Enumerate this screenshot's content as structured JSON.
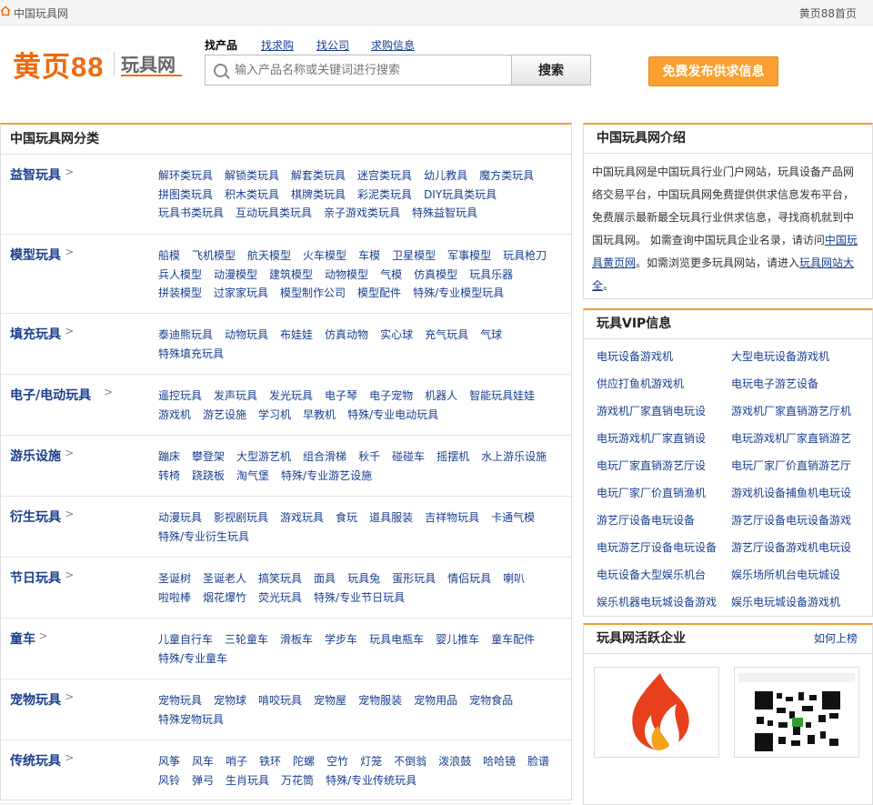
{
  "topbar": {
    "site": "中国玩具网",
    "right": "黄页88首页"
  },
  "header": {
    "logo": "黄页88",
    "logo_sub": "玩具网",
    "tabs": [
      "找产品",
      "找求购",
      "找公司",
      "求购信息"
    ],
    "search_placeholder": "输入产品名称或关键词进行搜索",
    "search_button": "搜索",
    "publish_button": "免费发布供求信息"
  },
  "left": {
    "title": "中国玩具网分类",
    "categories": [
      {
        "name": "益智玩具",
        "links": [
          "解环类玩具",
          "解锁类玩具",
          "解套类玩具",
          "迷宫类玩具",
          "幼儿教具",
          "魔方类玩具",
          "拼图类玩具",
          "积木类玩具",
          "棋牌类玩具",
          "彩泥类玩具",
          "DIY玩具类玩具",
          "玩具书类玩具",
          "互动玩具类玩具",
          "亲子游戏类玩具",
          "特殊益智玩具"
        ]
      },
      {
        "name": "模型玩具",
        "links": [
          "船模",
          "飞机模型",
          "航天模型",
          "火车模型",
          "车模",
          "卫星模型",
          "军事模型",
          "玩具枪刀",
          "兵人模型",
          "动漫模型",
          "建筑模型",
          "动物模型",
          "气模",
          "仿真模型",
          "玩具乐器",
          "拼装模型",
          "过家家玩具",
          "模型制作公司",
          "模型配件",
          "特殊/专业模型玩具"
        ]
      },
      {
        "name": "填充玩具",
        "links": [
          "泰迪熊玩具",
          "动物玩具",
          "布娃娃",
          "仿真动物",
          "实心球",
          "充气玩具",
          "气球",
          "特殊填充玩具"
        ]
      },
      {
        "name": "电子/电动玩具",
        "links": [
          "遥控玩具",
          "发声玩具",
          "发光玩具",
          "电子琴",
          "电子宠物",
          "机器人",
          "智能玩具娃娃",
          "游戏机",
          "游艺设施",
          "学习机",
          "早教机",
          "特殊/专业电动玩具"
        ]
      },
      {
        "name": "游乐设施",
        "links": [
          "蹦床",
          "攀登架",
          "大型游艺机",
          "组合滑梯",
          "秋千",
          "碰碰车",
          "摇摆机",
          "水上游乐设施",
          "转椅",
          "跷跷板",
          "淘气堡",
          "特殊/专业游艺设施"
        ]
      },
      {
        "name": "衍生玩具",
        "links": [
          "动漫玩具",
          "影视剧玩具",
          "游戏玩具",
          "食玩",
          "道具服装",
          "吉祥物玩具",
          "卡通气模",
          "特殊/专业衍生玩具"
        ]
      },
      {
        "name": "节日玩具",
        "links": [
          "圣诞树",
          "圣诞老人",
          "搞笑玩具",
          "面具",
          "玩具兔",
          "蛋形玩具",
          "情侣玩具",
          "喇叭",
          "啦啦棒",
          "烟花爆竹",
          "荧光玩具",
          "特殊/专业节日玩具"
        ]
      },
      {
        "name": "童车",
        "links": [
          "儿童自行车",
          "三轮童车",
          "滑板车",
          "学步车",
          "玩具电瓶车",
          "婴儿推车",
          "童车配件",
          "特殊/专业童车"
        ]
      },
      {
        "name": "宠物玩具",
        "links": [
          "宠物玩具",
          "宠物球",
          "啃咬玩具",
          "宠物屋",
          "宠物服装",
          "宠物用品",
          "宠物食品",
          "特殊宠物玩具"
        ]
      },
      {
        "name": "传统玩具",
        "links": [
          "风筝",
          "风车",
          "哨子",
          "铁环",
          "陀螺",
          "空竹",
          "灯笼",
          "不倒翁",
          "泼浪鼓",
          "哈哈镜",
          "脸谱",
          "风铃",
          "弹弓",
          "生肖玩具",
          "万花筒",
          "特殊/专业传统玩具"
        ]
      }
    ]
  },
  "intro": {
    "title": "中国玩具网介绍",
    "text1": "中国玩具网是中国玩具行业门户网站，玩具设备产品网络交易平台，中国玩具网免费提供供求信息发布平台，免费展示最新最全玩具行业供求信息，寻找商机就到中国玩具网。 如需查询中国玩具企业名录，请访问",
    "link1": "中国玩具黄页网",
    "text2": "。如需浏览更多玩具网站，请进入",
    "link2": "玩具网站大全",
    "text3": "。"
  },
  "vip": {
    "title": "玩具VIP信息",
    "items": [
      "电玩设备游戏机",
      "大型电玩设备游戏机",
      "供应打鱼机游戏机",
      "电玩电子游艺设备",
      "游戏机厂家直销电玩设",
      "游戏机厂家直销游艺厅机",
      "电玩游戏机厂家直销设",
      "电玩游戏机厂家直销游艺",
      "电玩厂家直销游艺厅设",
      "电玩厂家厂价直销游艺厅",
      "电玩厂家厂价直销渔机",
      "游戏机设备捕鱼机电玩设",
      "游艺厅设备电玩设备",
      "游艺厅设备电玩设备游戏",
      "电玩游艺厅设备电玩设备",
      "游艺厅设备游戏机电玩设",
      "电玩设备大型娱乐机台",
      "娱乐场所机台电玩城设",
      "娱乐机器电玩城设备游戏",
      "娱乐电玩城设备游戏机"
    ]
  },
  "active": {
    "title": "玩具网活跃企业",
    "more": "如何上榜"
  },
  "colors": {
    "accent": "#f06a0c",
    "link": "#1a3f8f",
    "button": "#f9a030"
  }
}
